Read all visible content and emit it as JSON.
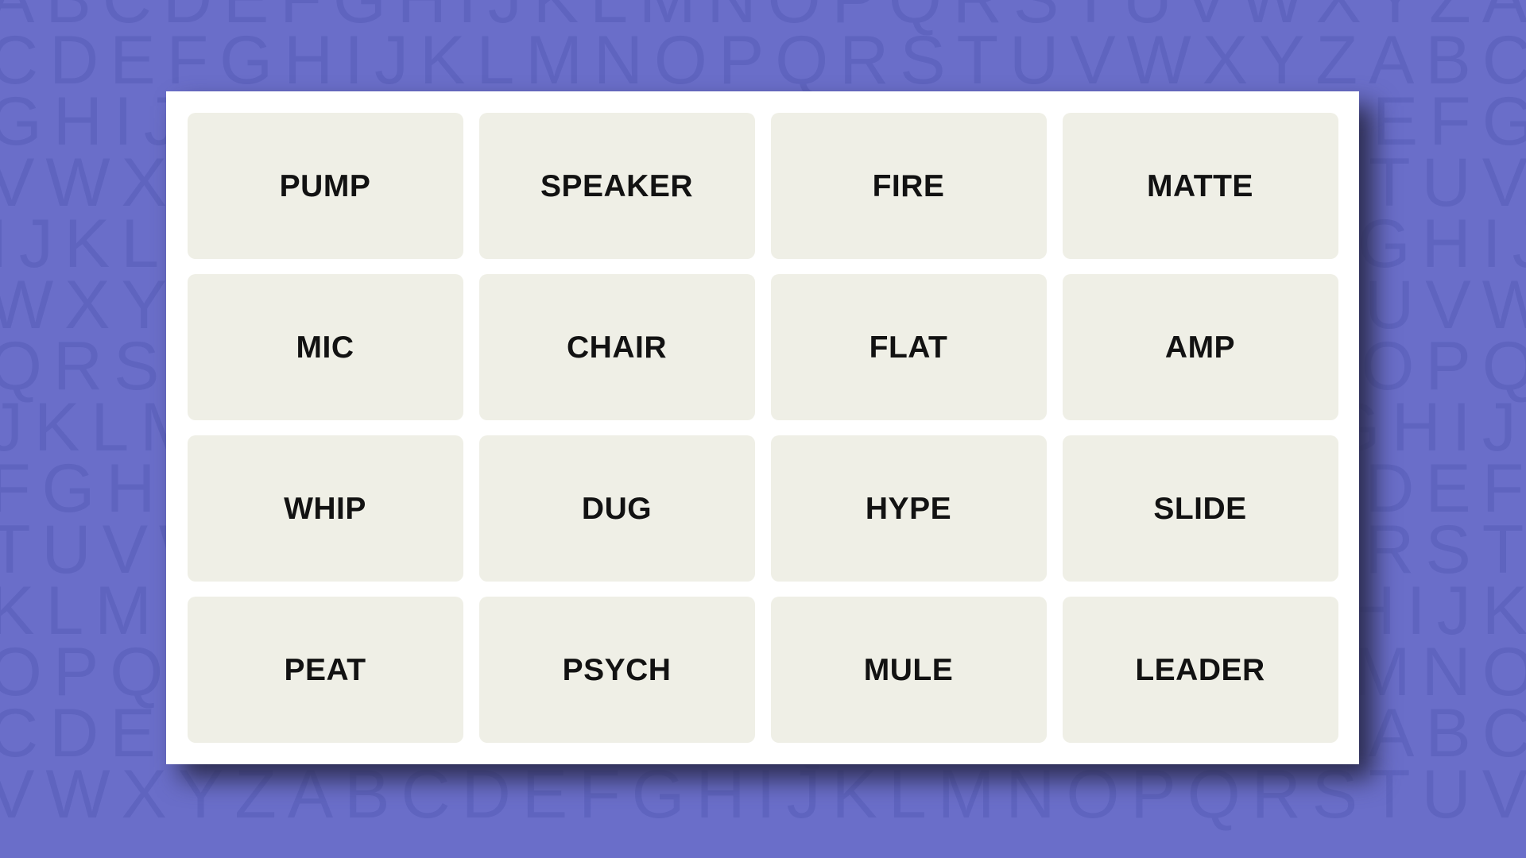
{
  "theme": {
    "background_color": "#6a6ec9",
    "background_letter_color": "#5f64bf",
    "panel_color": "#ffffff",
    "tile_color": "#efefe6",
    "tile_text_color": "#121212",
    "shadow_color": "#2b2b4e"
  },
  "background": {
    "pattern_name": "alphabet-tiling",
    "rows": [
      "ABCDEFGHIJKLMNOPQRSTUVWXYZABCDEFGHIJ",
      "CDEFGHIJKLMNOPQRSTUVWXYZABCDEFGHIJKL",
      "GHIJKLMNOPQRSTUVWXYZABCDEFGHIJKLMNOP",
      "VWXYZABCDEFGHIJKLMNOPQRSTUVWXYZABCDE",
      "IJKLMNOPQRSTUVWXYZABCDEFGHIJKLMNOPQR",
      "WXYZABCDEFGHIJKLMNOPQRSTUVWXYZABCDEF",
      "QRSTUVWXYZABCDEFGHIJKLMNOPQRSTUVWXYZ",
      "JKLMNOPQRSTUVWXYZABCDEFGHIJKLMNOPQRS",
      "FGHIJKLMNOPQRSTUVWXYZABCDEFGHIJKLMNO",
      "TUVWXYZABCDEFGHIJKLMNOPQRSTUVWXYZABC",
      "KLMNOPQRSTUVWXYZABCDEFGHIJKLMNOPQRST",
      "OPQRSTUVWXYZABCDEFGHIJKLMNOPQRSTUVWX",
      "CDEFGHIJKLMNOPQRSTUVWXYZABCDEFGHIJKL",
      "VWXYZABCDEFGHIJKLMNOPQRSTUVWXYZABCDE"
    ]
  },
  "board": {
    "columns": 4,
    "rows": 4,
    "tiles": [
      {
        "word": "PUMP",
        "row": 1,
        "col": 1,
        "selected": false
      },
      {
        "word": "SPEAKER",
        "row": 1,
        "col": 2,
        "selected": false
      },
      {
        "word": "FIRE",
        "row": 1,
        "col": 3,
        "selected": false
      },
      {
        "word": "MATTE",
        "row": 1,
        "col": 4,
        "selected": false
      },
      {
        "word": "MIC",
        "row": 2,
        "col": 1,
        "selected": false
      },
      {
        "word": "CHAIR",
        "row": 2,
        "col": 2,
        "selected": false
      },
      {
        "word": "FLAT",
        "row": 2,
        "col": 3,
        "selected": false
      },
      {
        "word": "AMP",
        "row": 2,
        "col": 4,
        "selected": false
      },
      {
        "word": "WHIP",
        "row": 3,
        "col": 1,
        "selected": false
      },
      {
        "word": "DUG",
        "row": 3,
        "col": 2,
        "selected": false
      },
      {
        "word": "HYPE",
        "row": 3,
        "col": 3,
        "selected": false
      },
      {
        "word": "SLIDE",
        "row": 3,
        "col": 4,
        "selected": false
      },
      {
        "word": "PEAT",
        "row": 4,
        "col": 1,
        "selected": false
      },
      {
        "word": "PSYCH",
        "row": 4,
        "col": 2,
        "selected": false
      },
      {
        "word": "MULE",
        "row": 4,
        "col": 3,
        "selected": false
      },
      {
        "word": "LEADER",
        "row": 4,
        "col": 4,
        "selected": false
      }
    ]
  }
}
